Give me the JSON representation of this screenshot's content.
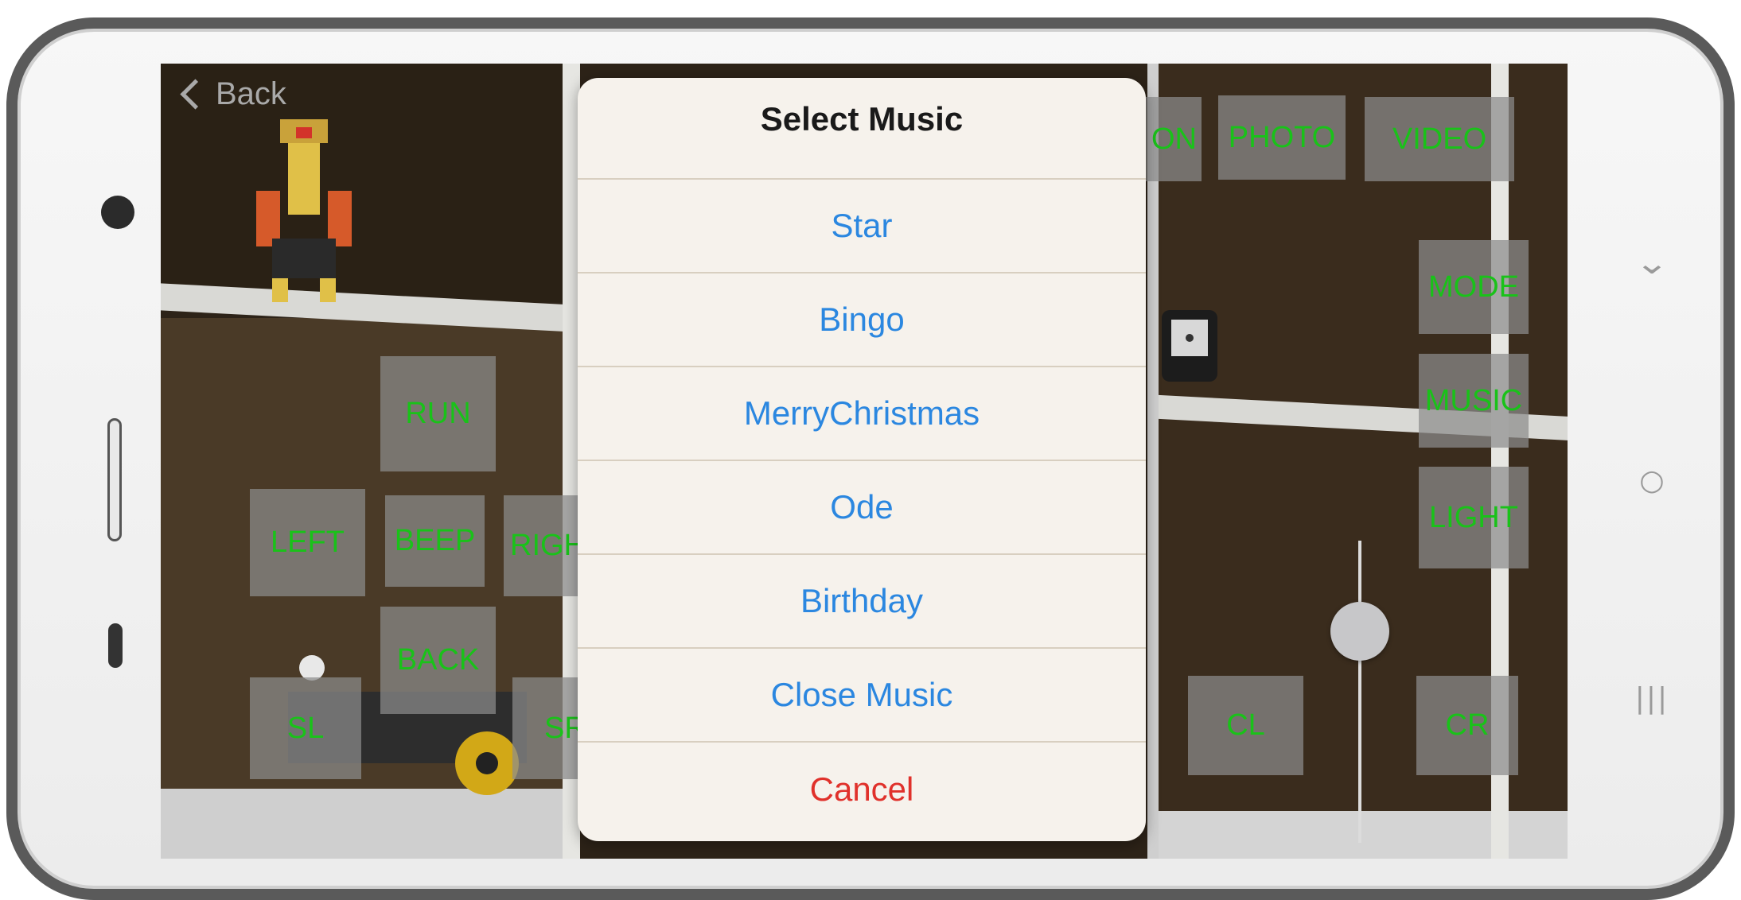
{
  "nav": {
    "back_label": "Back"
  },
  "controls": {
    "run": "RUN",
    "left": "LEFT",
    "beep": "BEEP",
    "right": "RIGH",
    "back": "BACK",
    "sl": "SL",
    "sr": "SR",
    "on": "ON",
    "photo": "PHOTO",
    "video": "VIDEO",
    "mode": "MODE",
    "music": "MUSIC",
    "light": "LIGHT",
    "cl": "CL",
    "cr": "CR"
  },
  "slider": {
    "value": 0.3
  },
  "action_sheet": {
    "title": "Select Music",
    "options": [
      "Star",
      "Bingo",
      "MerryChristmas",
      "Ode",
      "Birthday",
      "Close Music"
    ],
    "cancel": "Cancel"
  },
  "colors": {
    "control_text": "#19c219",
    "option_text": "#2b87e0",
    "cancel_text": "#e0312b"
  },
  "icons": {
    "back": "chevron-left-icon",
    "nav_down": "chevron-down-icon",
    "nav_home": "circle-home-icon",
    "nav_recent": "recent-apps-icon"
  }
}
